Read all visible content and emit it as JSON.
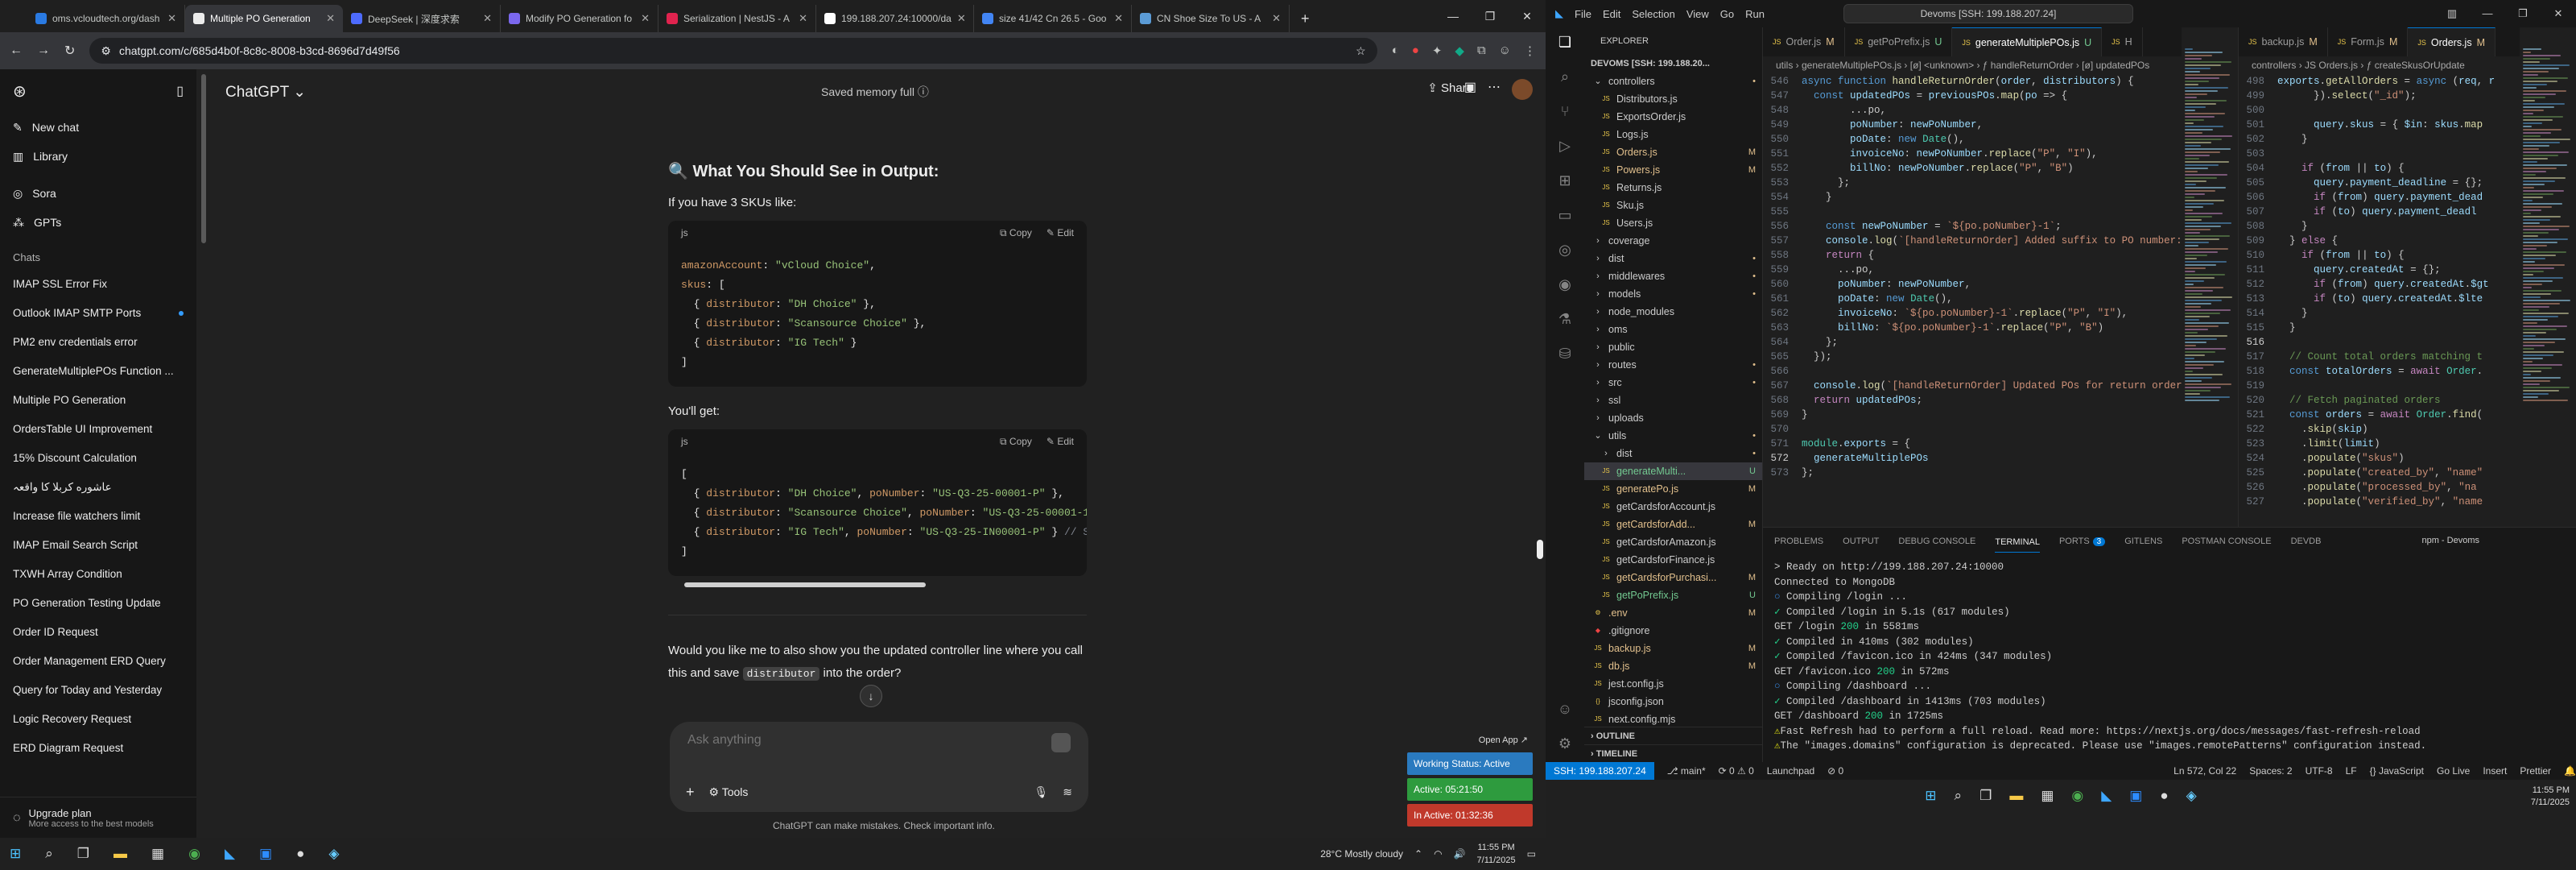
{
  "browser": {
    "tabs": [
      {
        "label": "oms.vcloudtech.org/dash",
        "color": "#2a7ae2"
      },
      {
        "label": "Multiple PO Generation",
        "color": "#ececec",
        "active": true
      },
      {
        "label": "DeepSeek | 深度求索",
        "color": "#4d6bfe"
      },
      {
        "label": "Modify PO Generation fo",
        "color": "#7b68ee"
      },
      {
        "label": "Serialization | NestJS - A",
        "color": "#e0234e"
      },
      {
        "label": "199.188.207.24:10000/da",
        "color": "#ffffff"
      },
      {
        "label": "size 41/42 Cn 26.5 - Goo",
        "color": "#4285f4"
      },
      {
        "label": "CN Shoe Size To US - A",
        "color": "#5b9bd5"
      }
    ],
    "url": "chatgpt.com/c/685d4b0f-8c8c-8008-b3cd-8696d7d49f56",
    "win": [
      "—",
      "❐",
      "✕"
    ]
  },
  "sidebar": {
    "top_items": [
      {
        "icon": "✎",
        "label": "New chat"
      },
      {
        "icon": "▥",
        "label": "Library"
      }
    ],
    "mid_items": [
      {
        "icon": "◎",
        "label": "Sora"
      },
      {
        "icon": "⁂",
        "label": "GPTs"
      }
    ],
    "chats_heading": "Chats",
    "chats": [
      "IMAP SSL Error Fix",
      "Outlook IMAP SMTP Ports",
      "PM2 env credentials error",
      "GenerateMultiplePOs Function ...",
      "Multiple PO Generation",
      "OrdersTable UI Improvement",
      "15% Discount Calculation",
      "عاشوره کربلا کا واقعہ",
      "Increase file watchers limit",
      "IMAP Email Search Script",
      "TXWH Array Condition",
      "PO Generation Testing Update",
      "Order ID Request",
      "Order Management ERD Query",
      "Query for Today and Yesterday",
      "Logic Recovery Request",
      "ERD Diagram Request"
    ],
    "upgrade_title": "Upgrade plan",
    "upgrade_sub": "More access to the best models"
  },
  "chat": {
    "model": "ChatGPT",
    "memory": "Saved memory full",
    "share": "Share",
    "heading": "🔍 What You Should See in Output:",
    "intro": "If you have 3 SKUs like:",
    "code1_lang": "js",
    "copy": "Copy",
    "edit": "Edit",
    "after": "You'll get:",
    "code2_lang": "js",
    "question_a": "Would you like me to also show you the updated controller line where you call this and save ",
    "question_code": "distributor",
    "question_b": " into the order?",
    "placeholder": "Ask anything",
    "tools": "Tools",
    "disclaimer": "ChatGPT can make mistakes. Check important info."
  },
  "widget": {
    "open": "Open App ↗",
    "status": "Working Status: Active",
    "active": "Active: 05:21:50",
    "inactive": "In Active: 01:32:36"
  },
  "taskbar": {
    "weather": "28°C  Mostly cloudy",
    "time": "11:55 PM",
    "date": "7/11/2025"
  },
  "vscode": {
    "menu": [
      "File",
      "Edit",
      "Selection",
      "View",
      "Go",
      "Run"
    ],
    "search": "Devoms [SSH: 199.188.207.24]",
    "explorer_title": "EXPLORER",
    "root": "DEVOMS [SSH: 199.188.20...",
    "files": [
      {
        "n": "controllers",
        "t": "folder",
        "d": 1,
        "open": true,
        "s": "•"
      },
      {
        "n": "Distributors.js",
        "t": "js",
        "d": 2
      },
      {
        "n": "ExportsOrder.js",
        "t": "js",
        "d": 2
      },
      {
        "n": "Logs.js",
        "t": "js",
        "d": 2
      },
      {
        "n": "Orders.js",
        "t": "js",
        "d": 2,
        "s": "M"
      },
      {
        "n": "Powers.js",
        "t": "js",
        "d": 2,
        "s": "M"
      },
      {
        "n": "Returns.js",
        "t": "js",
        "d": 2
      },
      {
        "n": "Sku.js",
        "t": "js",
        "d": 2
      },
      {
        "n": "Users.js",
        "t": "js",
        "d": 2
      },
      {
        "n": "coverage",
        "t": "folder",
        "d": 1
      },
      {
        "n": "dist",
        "t": "folder",
        "d": 1,
        "s": "•"
      },
      {
        "n": "middlewares",
        "t": "folder",
        "d": 1,
        "s": "•"
      },
      {
        "n": "models",
        "t": "folder",
        "d": 1,
        "s": "•"
      },
      {
        "n": "node_modules",
        "t": "folder",
        "d": 1
      },
      {
        "n": "oms",
        "t": "folder",
        "d": 1
      },
      {
        "n": "public",
        "t": "folder",
        "d": 1
      },
      {
        "n": "routes",
        "t": "folder",
        "d": 1,
        "s": "•"
      },
      {
        "n": "src",
        "t": "folder",
        "d": 1,
        "s": "•"
      },
      {
        "n": "ssl",
        "t": "folder",
        "d": 1
      },
      {
        "n": "uploads",
        "t": "folder",
        "d": 1
      },
      {
        "n": "utils",
        "t": "folder",
        "d": 1,
        "open": true,
        "s": "•"
      },
      {
        "n": "dist",
        "t": "folder",
        "d": 2,
        "s": "•"
      },
      {
        "n": "generateMulti...",
        "t": "js",
        "d": 2,
        "s": "U",
        "sel": true
      },
      {
        "n": "generatePo.js",
        "t": "js",
        "d": 2,
        "s": "M"
      },
      {
        "n": "getCardsforAccount.js",
        "t": "js",
        "d": 2
      },
      {
        "n": "getCardsforAdd...",
        "t": "js",
        "d": 2,
        "s": "M"
      },
      {
        "n": "getCardsforAmazon.js",
        "t": "js",
        "d": 2
      },
      {
        "n": "getCardsforFinance.js",
        "t": "js",
        "d": 2
      },
      {
        "n": "getCardsforPurchasi...",
        "t": "js",
        "d": 2,
        "s": "M"
      },
      {
        "n": "getPoPrefix.js",
        "t": "js",
        "d": 2,
        "s": "U"
      },
      {
        "n": ".env",
        "t": "env",
        "d": 1,
        "s": "M"
      },
      {
        "n": ".gitignore",
        "t": "git",
        "d": 1
      },
      {
        "n": "backup.js",
        "t": "js",
        "d": 1,
        "s": "M"
      },
      {
        "n": "db.js",
        "t": "js",
        "d": 1,
        "s": "M"
      },
      {
        "n": "jest.config.js",
        "t": "js",
        "d": 1
      },
      {
        "n": "jsconfig.json",
        "t": "json",
        "d": 1
      },
      {
        "n": "next.config.mjs",
        "t": "js",
        "d": 1
      }
    ],
    "outline": "OUTLINE",
    "timeline": "TIMELINE",
    "left_tabs": [
      {
        "l": "Order.js",
        "s": "M"
      },
      {
        "l": "getPoPrefix.js",
        "s": "U"
      },
      {
        "l": "generateMultiplePOs.js",
        "s": "U",
        "act": true
      },
      {
        "l": "H",
        "s": ""
      }
    ],
    "left_crumb": "utils › generateMultiplePOs.js › [ø] <unknown> › ƒ handleReturnOrder › [ø] updatedPOs",
    "right_tabs": [
      {
        "l": "backup.js",
        "s": "M"
      },
      {
        "l": "Form.js",
        "s": "M"
      },
      {
        "l": "Orders.js",
        "s": "M",
        "act": true
      }
    ],
    "right_crumb": "controllers › JS Orders.js › ƒ createSkusOrUpdate",
    "panel_tabs": [
      "PROBLEMS",
      "OUTPUT",
      "DEBUG CONSOLE",
      "TERMINAL",
      "PORTS",
      "GITLENS",
      "POSTMAN CONSOLE",
      "DEVDB"
    ],
    "ports_count": "3",
    "term_name": "npm - Devoms",
    "status_left": [
      "SSH: 199.188.207.24",
      "⎇ main*",
      "⟳ 0 ⚠ 0",
      "Launchpad",
      "⊘ 0"
    ],
    "status_right": [
      "Ln 572, Col 22",
      "Spaces: 2",
      "UTF-8",
      "LF",
      "{} JavaScript",
      "Go Live",
      "Insert",
      "Prettier"
    ],
    "time": "11:55 PM",
    "date": "7/11/2025"
  }
}
